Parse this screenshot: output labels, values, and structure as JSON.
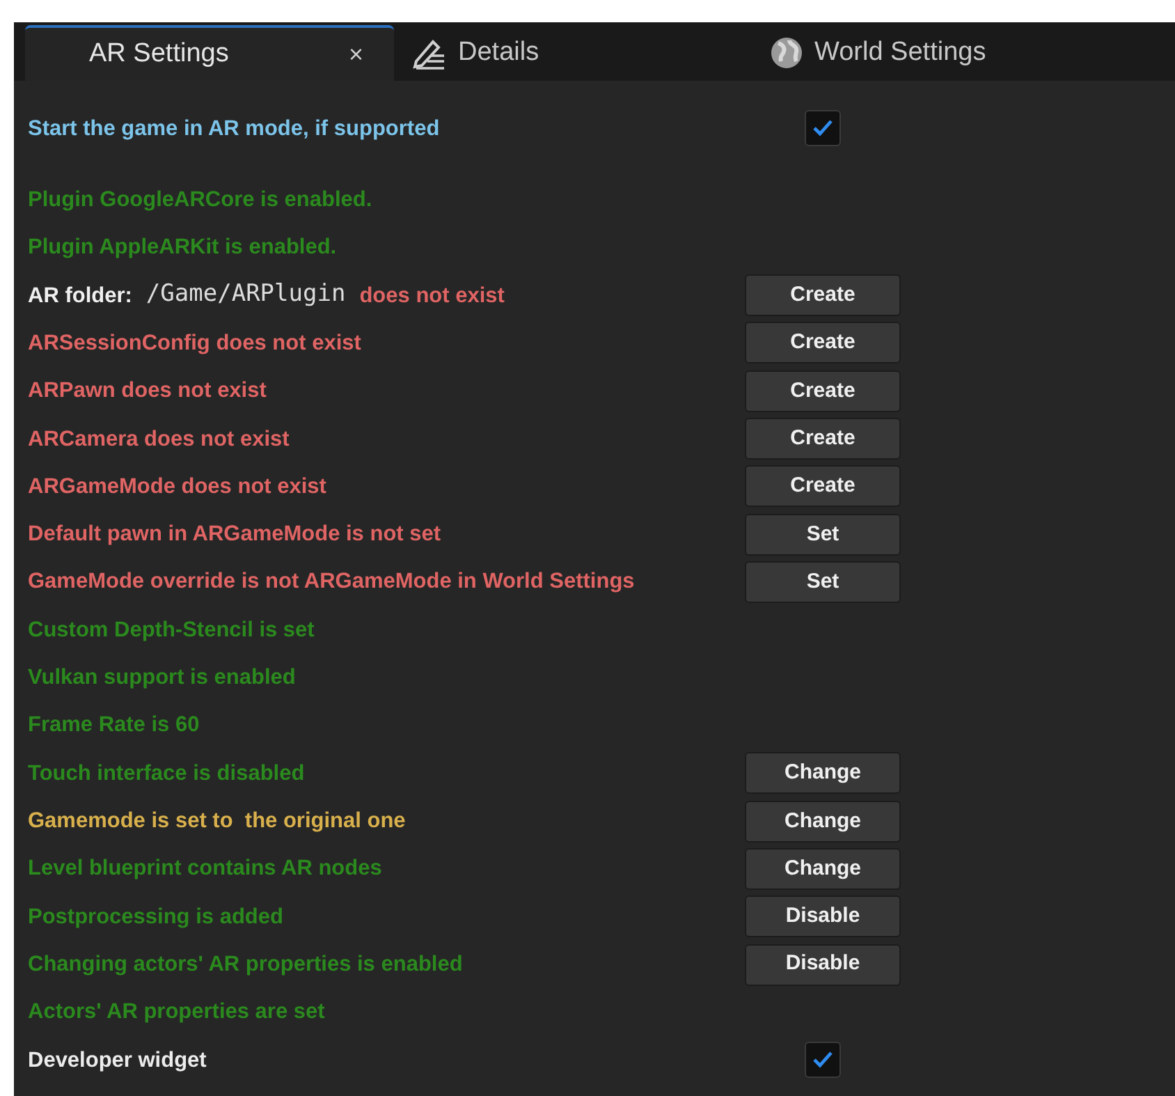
{
  "tabs": [
    {
      "label": "AR Settings",
      "kind": "plain",
      "close": "×",
      "selected": true
    },
    {
      "label": "Details",
      "kind": "pencil",
      "selected": false
    },
    {
      "label": "World Settings",
      "kind": "globe",
      "selected": false
    }
  ],
  "rows": [
    {
      "kind": "check",
      "label": "Start the game in AR mode, if supported",
      "color": "#7cc4ea",
      "checked": true
    },
    {
      "kind": "text",
      "label": "Plugin GoogleARCore is enabled.",
      "color": "#2b8a1e"
    },
    {
      "kind": "text",
      "label": "Plugin AppleARKit is enabled.",
      "color": "#2b8a1e"
    },
    {
      "kind": "folder",
      "label": "AR folder:",
      "path": "/Game/ARPlugin",
      "message": "does not exist",
      "color": "#e06464",
      "button": "Create"
    },
    {
      "kind": "text",
      "label": "ARSessionConfig does not exist",
      "color": "#e06464",
      "button": "Create"
    },
    {
      "kind": "text",
      "label": "ARPawn does not exist",
      "color": "#e06464",
      "button": "Create"
    },
    {
      "kind": "text",
      "label": "ARCamera does not exist",
      "color": "#e06464",
      "button": "Create"
    },
    {
      "kind": "text",
      "label": "ARGameMode does not exist",
      "color": "#e06464",
      "button": "Create"
    },
    {
      "kind": "text",
      "label": "Default pawn in ARGameMode is not set",
      "color": "#e06464",
      "button": "Set"
    },
    {
      "kind": "text",
      "label": "GameMode override is not ARGameMode in World Settings",
      "color": "#e06464",
      "button": "Set"
    },
    {
      "kind": "text",
      "label": "Custom Depth-Stencil is set",
      "color": "#2b8a1e"
    },
    {
      "kind": "text",
      "label": "Vulkan support is enabled",
      "color": "#2b8a1e"
    },
    {
      "kind": "text",
      "label": "Frame Rate is 60",
      "color": "#2b8a1e"
    },
    {
      "kind": "text",
      "label": "Touch interface is disabled",
      "color": "#2b8a1e",
      "button": "Change"
    },
    {
      "kind": "text",
      "label": "Gamemode is set to  the original one",
      "color": "#d8b04c",
      "button": "Change"
    },
    {
      "kind": "text",
      "label": "Level blueprint contains AR nodes",
      "color": "#2b8a1e",
      "button": "Change"
    },
    {
      "kind": "text",
      "label": "Postprocessing is added",
      "color": "#2b8a1e",
      "button": "Disable"
    },
    {
      "kind": "text",
      "label": "Changing actors' AR properties is enabled",
      "color": "#2b8a1e",
      "button": "Disable"
    },
    {
      "kind": "text",
      "label": "Actors' AR properties are set",
      "color": "#2b8a1e"
    },
    {
      "kind": "check",
      "label": "Developer widget",
      "color": "#ececec",
      "checked": true
    }
  ]
}
